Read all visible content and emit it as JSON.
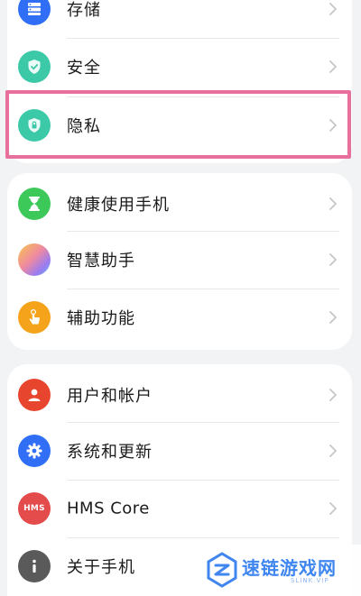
{
  "settings": {
    "group1": [
      {
        "label": "存储",
        "icon": "storage-icon",
        "color": "#2f6ef5"
      },
      {
        "label": "安全",
        "icon": "security-shield-icon",
        "color": "#3cc9a8"
      },
      {
        "label": "隐私",
        "icon": "privacy-shield-icon",
        "color": "#3cc9a8"
      }
    ],
    "group2": [
      {
        "label": "健康使用手机",
        "icon": "hourglass-icon",
        "color": "#3cc95a"
      },
      {
        "label": "智慧助手",
        "icon": "assistant-orb-icon",
        "color": "#f29a7a"
      },
      {
        "label": "辅助功能",
        "icon": "hand-touch-icon",
        "color": "#f5a31a"
      }
    ],
    "group3": [
      {
        "label": "用户和帐户",
        "icon": "user-icon",
        "color": "#e8452f"
      },
      {
        "label": "系统和更新",
        "icon": "gear-icon",
        "color": "#2f6ef5"
      },
      {
        "label": "HMS Core",
        "icon": "hms-icon",
        "color": "#e44b4b",
        "icon_text": "HMS"
      },
      {
        "label": "关于手机",
        "icon": "info-icon",
        "color": "#5a5a5a"
      }
    ]
  },
  "highlight_color": "#e8709c",
  "watermark": {
    "text": "速链游戏网",
    "subtext": "SLINK.VIP"
  }
}
